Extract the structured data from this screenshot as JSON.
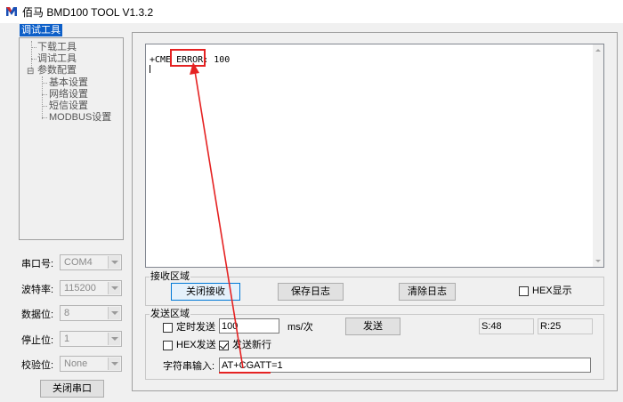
{
  "app": {
    "title": "佰马 BMD100 TOOL V1.3.2",
    "accent_color": "#0d5fc8",
    "annotation_color": "#e52222",
    "icon": "bm-logo-icon"
  },
  "left_panel": {
    "caption": "调试工具",
    "tree": {
      "items": [
        {
          "label": "下载工具"
        },
        {
          "label": "调试工具"
        },
        {
          "label": "参数配置",
          "expander": "⊟"
        },
        {
          "label": "基本设置"
        },
        {
          "label": "网络设置"
        },
        {
          "label": "短信设置"
        },
        {
          "label": "MODBUS设置"
        }
      ]
    },
    "serial": {
      "port": {
        "label": "串口号:",
        "value": "COM4"
      },
      "baud": {
        "label": "波特率:",
        "value": "115200"
      },
      "data_bits": {
        "label": "数据位:",
        "value": "8"
      },
      "stop_bits": {
        "label": "停止位:",
        "value": "1"
      },
      "parity": {
        "label": "校验位:",
        "value": "None"
      }
    },
    "close_port_label": "关闭串口"
  },
  "receive": {
    "text": "+CME ERROR: 100",
    "group_title": "接收区域",
    "close_receive_label": "关闭接收",
    "save_log_label": "保存日志",
    "clear_log_label": "清除日志",
    "hex_display_label": "HEX显示",
    "hex_display_checked": false
  },
  "send": {
    "group_title": "发送区域",
    "timed_send_label": "定时发送",
    "timed_send_checked": false,
    "interval_value": "100",
    "interval_unit": "ms/次",
    "send_label": "发送",
    "sent_count": "S:48",
    "received_count": "R:25",
    "hex_send_label": "HEX发送",
    "hex_send_checked": false,
    "newline_label": "发送新行",
    "newline_checked": true,
    "string_input_label": "字符串输入:",
    "string_input_value": "AT+CGATT=1"
  }
}
